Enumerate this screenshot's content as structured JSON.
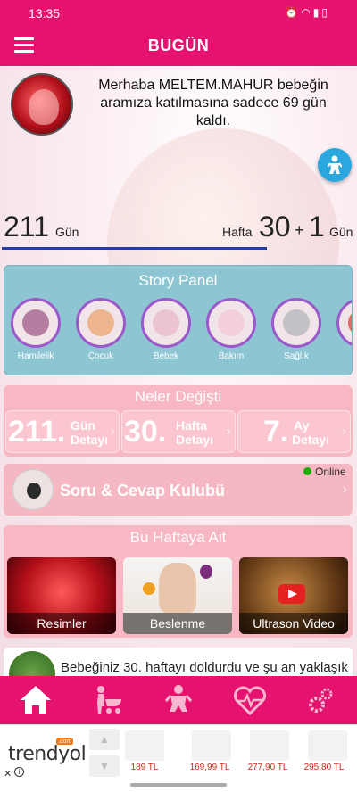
{
  "status_bar": {
    "time": "13:35"
  },
  "header": {
    "title": "BUGÜN"
  },
  "welcome": {
    "message": "Merhaba MELTEM.MAHUR bebeğin aramıza katılmasına sadece 69 gün kaldı."
  },
  "progress": {
    "days": "211",
    "days_label": "Gün",
    "week_label": "Hafta",
    "week": "30",
    "plus": "+",
    "day": "1",
    "day_label": "Gün",
    "fraction": 0.75
  },
  "story_panel": {
    "title": "Story Panel",
    "items": [
      {
        "label": "Hamilelik"
      },
      {
        "label": "Çocuk"
      },
      {
        "label": "Bebek"
      },
      {
        "label": "Bakım"
      },
      {
        "label": "Sağlık"
      }
    ]
  },
  "changes": {
    "title": "Neler Değişti",
    "tiles": [
      {
        "value": "211.",
        "line1": "Gün",
        "line2": "Detayı"
      },
      {
        "value": "30.",
        "line1": "Hafta",
        "line2": "Detayı"
      },
      {
        "value": "7.",
        "line1": "Ay",
        "line2": "Detayı"
      }
    ]
  },
  "qa": {
    "title": "Soru & Cevap Kulubü",
    "status": "Online"
  },
  "this_week": {
    "title": "Bu Haftaya Ait",
    "cards": [
      {
        "label": "Resimler"
      },
      {
        "label": "Beslenme"
      },
      {
        "label": "Ultrason Video"
      }
    ]
  },
  "info": {
    "text": "Bebeğiniz 30. haftayı doldurdu ve şu an yaklaşık"
  },
  "bottom_nav": {
    "items": [
      {
        "icon": "home-icon"
      },
      {
        "icon": "stroller-icon"
      },
      {
        "icon": "baby-icon"
      },
      {
        "icon": "heartbeat-icon"
      },
      {
        "icon": "gears-icon"
      }
    ]
  },
  "ad": {
    "brand": "trendyol",
    "brand_suffix": ".com",
    "prices": [
      "189 TL",
      "169,99 TL",
      "277,90 TL",
      "295,80 TL"
    ]
  },
  "colors": {
    "primary": "#e5136f",
    "story": "#8dc6d2",
    "soft_pink": "#f7b8c3",
    "fab": "#29a8e0",
    "online": "#19b000"
  }
}
